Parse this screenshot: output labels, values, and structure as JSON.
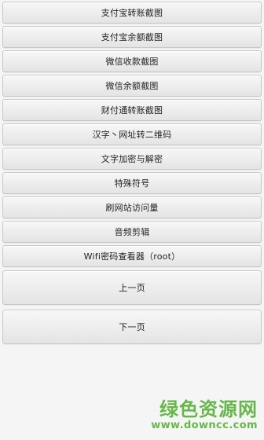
{
  "menu": {
    "items": [
      {
        "label": "支付宝转账截图"
      },
      {
        "label": "支付宝余额截图"
      },
      {
        "label": "微信收款截图"
      },
      {
        "label": "微信余额截图"
      },
      {
        "label": "财付通转账截图"
      },
      {
        "label": "汉字丶网址转二维码"
      },
      {
        "label": "文字加密与解密"
      },
      {
        "label": "特殊符号"
      },
      {
        "label": "刷网站访问量"
      },
      {
        "label": "音频剪辑"
      },
      {
        "label": "Wifi密码查看器（root）"
      },
      {
        "label": "上一页"
      },
      {
        "label": "下一页"
      }
    ]
  },
  "watermark": {
    "title": "绿色资源网",
    "url": "www.downcc.com"
  }
}
